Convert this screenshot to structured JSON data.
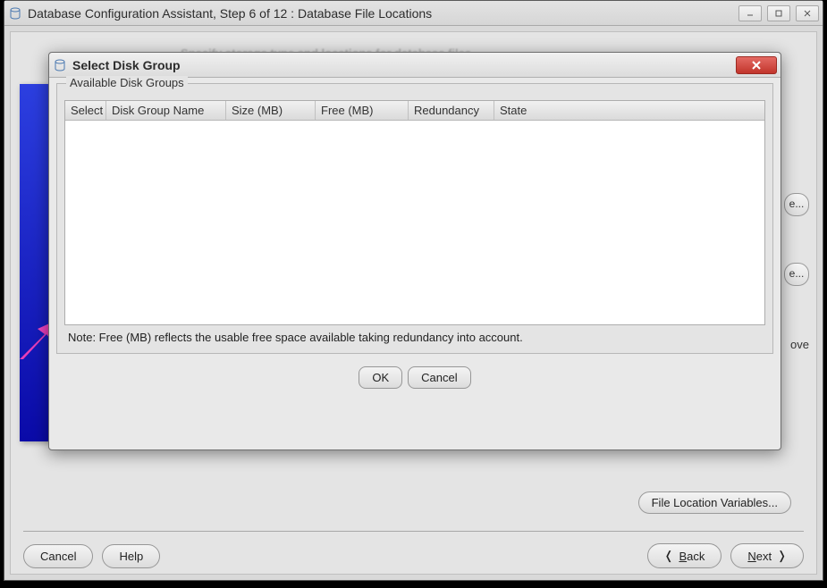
{
  "parent_window": {
    "title": "Database Configuration Assistant, Step 6 of 12 : Database File Locations",
    "file_location_variables_btn": "File Location Variables...",
    "browse_peek_label": "e...",
    "side_text_fragment": "ove",
    "buttons": {
      "cancel": "Cancel",
      "help": "Help",
      "back": "Back",
      "next": "Next"
    }
  },
  "dialog": {
    "title": "Select Disk Group",
    "group_legend": "Available Disk Groups",
    "columns": {
      "select": "Select",
      "name": "Disk Group Name",
      "size": "Size (MB)",
      "free": "Free (MB)",
      "redundancy": "Redundancy",
      "state": "State"
    },
    "rows": [],
    "note": "Note:  Free (MB) reflects the usable free space available taking redundancy into account.",
    "buttons": {
      "ok": "OK",
      "cancel": "Cancel"
    }
  }
}
